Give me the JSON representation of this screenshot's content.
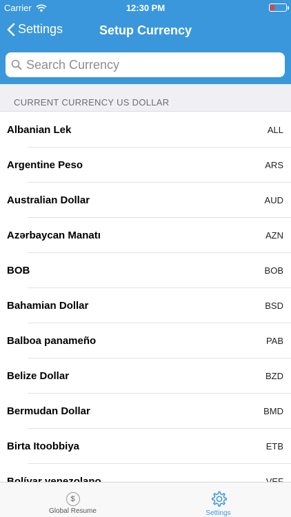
{
  "status": {
    "carrier": "Carrier",
    "time": "12:30 PM",
    "battery_level": 0.25
  },
  "nav": {
    "back_label": "Settings",
    "title": "Setup Currency"
  },
  "search": {
    "placeholder": "Search Currency",
    "value": ""
  },
  "section": {
    "header": "CURRENT CURRENCY US DOLLAR"
  },
  "currencies": [
    {
      "name": "Albanian Lek",
      "code": "ALL"
    },
    {
      "name": "Argentine Peso",
      "code": "ARS"
    },
    {
      "name": "Australian Dollar",
      "code": "AUD"
    },
    {
      "name": "Azərbaycan Manatı",
      "code": "AZN"
    },
    {
      "name": "BOB",
      "code": "BOB"
    },
    {
      "name": "Bahamian Dollar",
      "code": "BSD"
    },
    {
      "name": "Balboa panameño",
      "code": "PAB"
    },
    {
      "name": "Belize Dollar",
      "code": "BZD"
    },
    {
      "name": "Bermudan Dollar",
      "code": "BMD"
    },
    {
      "name": "Birta Itoobbiya",
      "code": "ETB"
    },
    {
      "name": "Bolívar venezolano",
      "code": "VEF"
    }
  ],
  "tabbar": {
    "tabs": [
      {
        "label": "Global Resume",
        "icon": "dollar-circle-icon",
        "active": false
      },
      {
        "label": "Settings",
        "icon": "gear-icon",
        "active": true
      }
    ],
    "active_color": "#3a97db"
  },
  "colors": {
    "accent": "#3a97db",
    "battery_low": "#e64040"
  }
}
